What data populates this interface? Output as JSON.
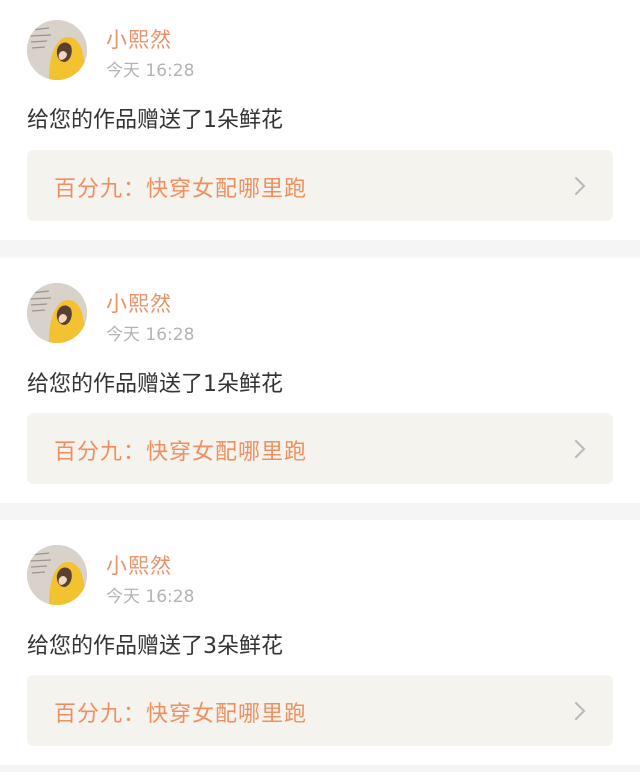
{
  "notifications": [
    {
      "username": "小熙然",
      "time": "今天 16:28",
      "message": "给您的作品赠送了1朵鲜花",
      "work_title": "百分九：快穿女配哪里跑"
    },
    {
      "username": "小熙然",
      "time": "今天 16:28",
      "message": "给您的作品赠送了1朵鲜花",
      "work_title": "百分九：快穿女配哪里跑"
    },
    {
      "username": "小熙然",
      "time": "今天 16:28",
      "message": "给您的作品赠送了3朵鲜花",
      "work_title": "百分九：快穿女配哪里跑"
    }
  ],
  "icons": {
    "chevron": "chevron-right-icon",
    "avatar": "avatar"
  },
  "colors": {
    "accent_pink": "#e8609a",
    "username": "#e8926a",
    "work_title": "#ef8f5f",
    "time": "#b3b3b3",
    "message": "#333333",
    "link_bg": "#f4f3ee"
  }
}
